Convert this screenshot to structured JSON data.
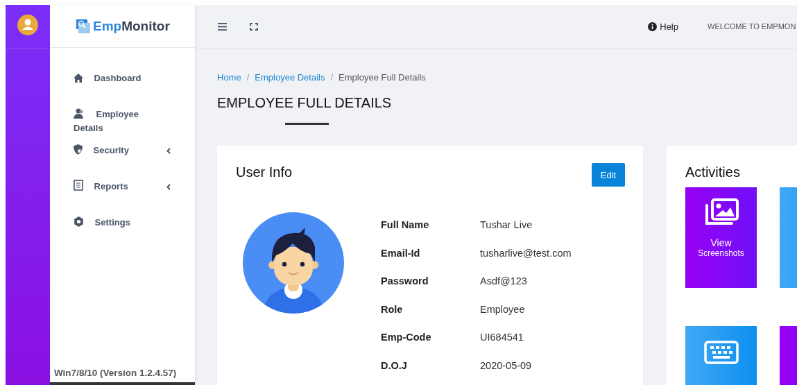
{
  "sidebar": {
    "brand": {
      "part1": "Emp",
      "part2": "Monitor"
    },
    "items": [
      {
        "label": "Dashboard",
        "kind": "home",
        "has_submenu": false
      },
      {
        "label": "Employee Details",
        "kind": "users",
        "has_submenu": false
      },
      {
        "label": "Security",
        "kind": "shield",
        "has_submenu": true
      },
      {
        "label": "Reports",
        "kind": "report",
        "has_submenu": true
      },
      {
        "label": "Settings",
        "kind": "gear",
        "has_submenu": false
      }
    ],
    "version": "Win7/8/10 (Version 1.2.4.57)"
  },
  "topbar": {
    "help": "Help",
    "welcome": "WELCOME TO EMPMON"
  },
  "breadcrumb": [
    {
      "label": "Home",
      "link": true,
      "separator": "/"
    },
    {
      "label": "Employee Details",
      "link": true,
      "separator": "/"
    },
    {
      "label": "Employee Full Details",
      "link": false
    }
  ],
  "page_title": "EMPLOYEE FULL DETAILS",
  "user_info": {
    "title": "User Info",
    "edit_button": "Edit",
    "fields": [
      {
        "label": "Full Name",
        "value": "Tushar Live"
      },
      {
        "label": "Email-Id",
        "value": "tusharlive@test.com"
      },
      {
        "label": "Password",
        "value": "Asdf@123"
      },
      {
        "label": "Role",
        "value": "Employee"
      },
      {
        "label": "Emp-Code",
        "value": "UI684541"
      },
      {
        "label": "D.O.J",
        "value": "2020-05-09"
      }
    ]
  },
  "activities": {
    "title": "Activities",
    "tiles": [
      {
        "kind": "screenshots",
        "color": "#9900f5",
        "lines": [
          "View",
          "Screenshots"
        ]
      },
      {
        "kind": "blank",
        "color": "#42a8f5"
      },
      {
        "kind": "keyboard",
        "color": "#42a8f5"
      },
      {
        "kind": "blank",
        "color": "#9900f5"
      }
    ]
  }
}
